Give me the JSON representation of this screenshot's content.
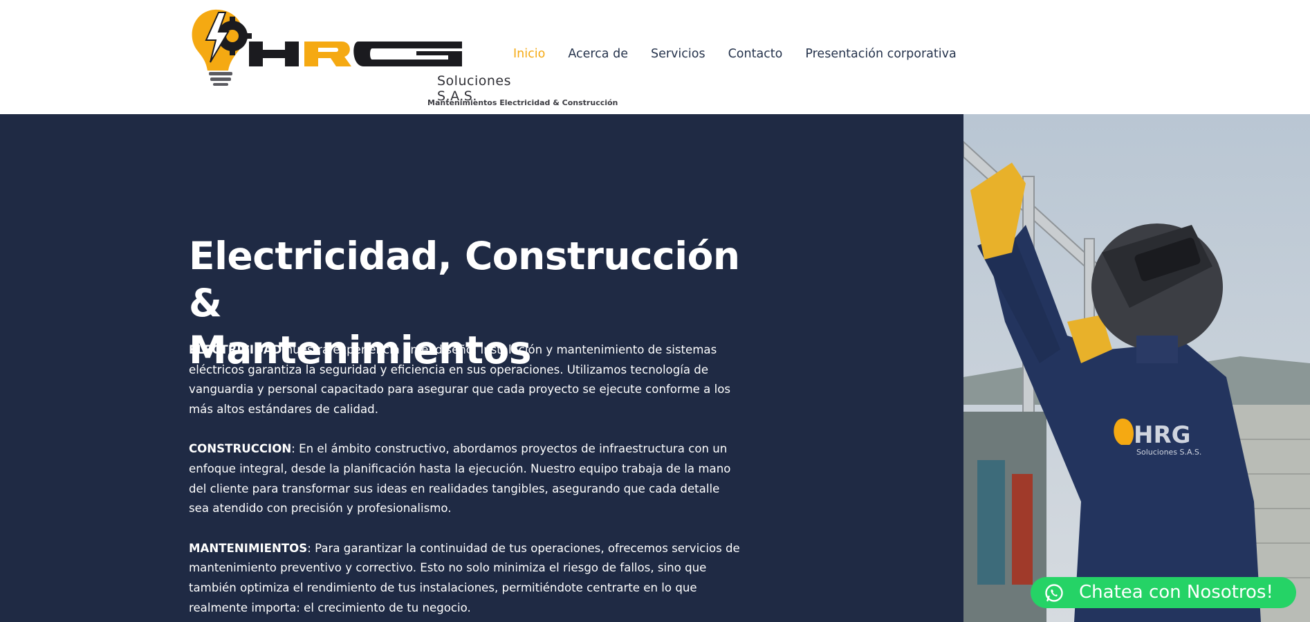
{
  "brand": {
    "logo_text": "HRG",
    "subtitle": "Soluciones S.A.S.",
    "tagline": "Mantenimientos Electricidad & Construcción",
    "colors": {
      "yellow": "#f5a912",
      "dark": "#1f2a44",
      "whatsapp": "#25d366"
    }
  },
  "nav": {
    "items": [
      {
        "label": "Inicio",
        "active": true
      },
      {
        "label": "Acerca de",
        "active": false
      },
      {
        "label": "Servicios",
        "active": false
      },
      {
        "label": "Contacto",
        "active": false
      },
      {
        "label": "Presentación corporativa",
        "active": false
      }
    ]
  },
  "hero": {
    "title_line1": "Electricidad, Construcción &",
    "title_line2": "Mantenimientos",
    "paragraphs": [
      {
        "lead": "ELECTRICIDAD",
        "text": " nuestra experiencia en el diseño, instalación y mantenimiento de sistemas eléctricos garantiza la seguridad y eficiencia en sus operaciones. Utilizamos tecnología de vanguardia y personal capacitado para asegurar que cada proyecto se ejecute conforme a los más altos estándares de calidad."
      },
      {
        "lead": "CONSTRUCCION",
        "text": ": En el ámbito constructivo, abordamos proyectos de infraestructura con un enfoque integral, desde la planificación hasta la ejecución. Nuestro equipo trabaja de la mano del cliente para transformar sus ideas en realidades tangibles, asegurando que cada detalle sea atendido con precisión y profesionalismo."
      },
      {
        "lead": "MANTENIMIENTOS",
        "text": ": Para garantizar la continuidad de tus operaciones, ofrecemos servicios de mantenimiento preventivo y correctivo. Esto no solo minimiza el riesgo de fallos, sino que también optimiza el rendimiento de tus instalaciones, permitiéndote centrarte en lo que realmente importa: el crecimiento de tu negocio."
      }
    ]
  },
  "photo": {
    "shirt_logo": "HRG",
    "shirt_sub": "Soluciones S.A.S.",
    "icon": "worker-photo"
  },
  "chat": {
    "label": "Chatea con Nosotros!",
    "icon": "whatsapp-icon"
  }
}
